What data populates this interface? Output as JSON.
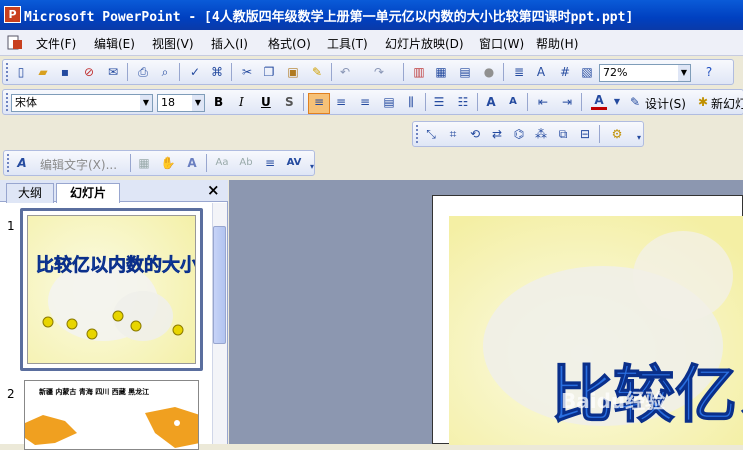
{
  "window": {
    "app_icon_label": "P",
    "title": "Microsoft PowerPoint - [4人教版四年级数学上册第一单元亿以内数的大小比较第四课时ppt.ppt]"
  },
  "menu": {
    "items": [
      "文件(F)",
      "编辑(E)",
      "视图(V)",
      "插入(I)",
      "格式(O)",
      "工具(T)",
      "幻灯片放映(D)",
      "窗口(W)",
      "帮助(H)"
    ]
  },
  "standard_toolbar": {
    "zoom": "72%"
  },
  "formatting_toolbar": {
    "font": "宋体",
    "size": "18",
    "bold": "B",
    "italic": "I",
    "underline": "U",
    "shadow": "S",
    "design_label": "设计(S)",
    "new_slide_label": "新幻灯"
  },
  "wordart_toolbar": {
    "edit_text_label": "编辑文字(X)..."
  },
  "outline_tabs": {
    "outline": "大纲",
    "slides": "幻灯片",
    "close": "×"
  },
  "thumbnails": [
    {
      "number": "1",
      "title": "比较亿以内数的大小",
      "selected": true
    },
    {
      "number": "2",
      "title": "新疆 内蒙古 青海 四川 西藏 黑龙江",
      "selected": false
    }
  ],
  "slide": {
    "wordart_text": "比较亿以内",
    "watermark": "Baidu经验"
  },
  "colors": {
    "title_bar": "#0a5bd8",
    "wordart_blue": "#2a6fe0",
    "selection_border": "#5a6e9e"
  }
}
